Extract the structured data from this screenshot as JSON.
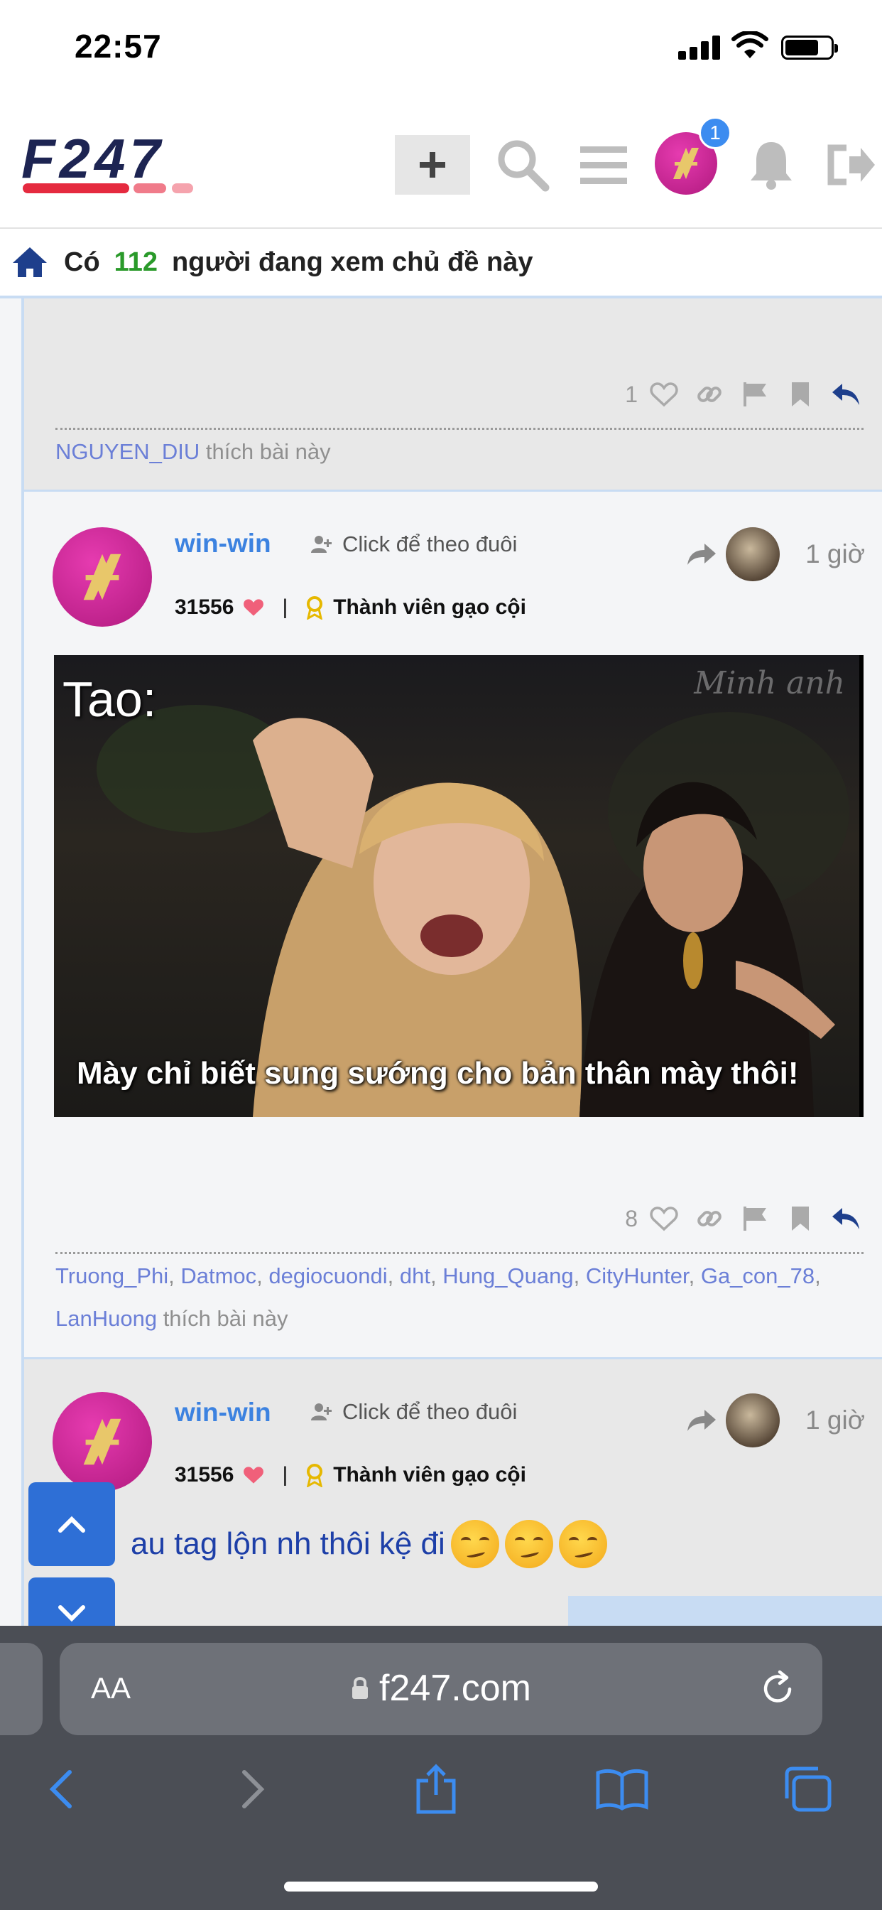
{
  "status_bar": {
    "time": "22:57"
  },
  "header": {
    "logo_text": "F247",
    "plus_label": "+",
    "notification_badge": "1"
  },
  "viewers": {
    "prefix": "Có",
    "count": "112",
    "suffix": "người đang xem chủ đề này"
  },
  "prev_post": {
    "like_count": "1",
    "liker": "NGUYEN_DIU",
    "likes_suffix": " thích bài này"
  },
  "post1": {
    "username": "win-win",
    "follow_label": "Click để theo đuôi",
    "points": "31556",
    "separator": "|",
    "rank": "Thành viên gạo cội",
    "time": "1 giờ",
    "meme_top": "Tao:",
    "meme_watermark": "Minh anh",
    "meme_caption": "Mày chỉ biết sung sướng cho bản thân mày thôi!",
    "like_count": "8",
    "likers": [
      "Truong_Phi",
      "Datmoc",
      "degiocuondi",
      "dht",
      "Hung_Quang",
      "CityHunter",
      "Ga_con_78",
      "LanHuong"
    ],
    "likes_suffix": " thích bài này"
  },
  "post2": {
    "username": "win-win",
    "follow_label": "Click để theo đuôi",
    "points": "31556",
    "separator": "|",
    "rank": "Thành viên gạo cội",
    "time": "1 giờ",
    "text": "au tag lộn nh thôi kệ đi"
  },
  "browser": {
    "text_size_label": "AA",
    "url": "f247.com"
  },
  "colors": {
    "accent_blue": "#3c82e0",
    "viewer_count_green": "#2a9a2a",
    "brand_pink": "#c0217f",
    "logo_navy": "#1d2452",
    "logo_red": "#e52a3f"
  }
}
